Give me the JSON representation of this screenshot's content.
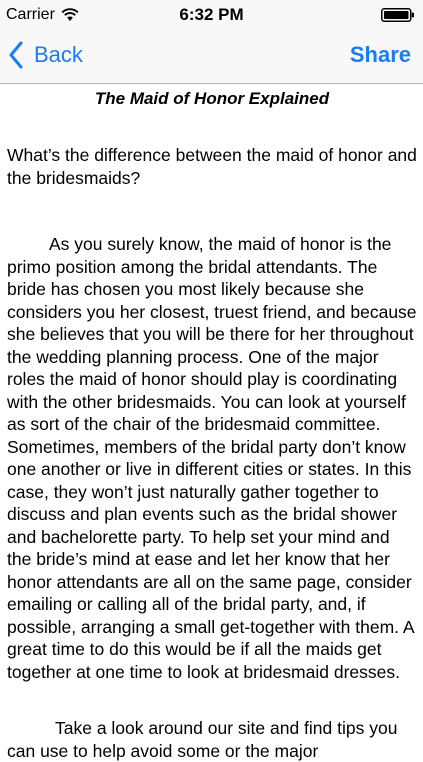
{
  "status_bar": {
    "carrier": "Carrier",
    "time": "6:32 PM",
    "wifi_icon": "wifi-icon",
    "battery_icon": "battery-icon"
  },
  "nav": {
    "back_label": "Back",
    "back_icon": "chevron-left-icon",
    "share_label": "Share",
    "accent_color": "#1a7cf5"
  },
  "article": {
    "title": "The Maid of Honor Explained",
    "question": "What’s the difference between the maid of honor and the bridesmaids?",
    "paragraph_1": "As you surely know, the maid of honor is the primo position among the bridal attendants. The bride has chosen you most likely because she considers you her closest, truest friend, and because she believes that you will be there for her throughout the wedding planning process. One of the major roles the maid of honor should play is coordinating with the other bridesmaids. You can look at yourself as sort of the chair of the bridesmaid committee. Sometimes, members of the bridal party don’t know one another or live in different cities or states. In this case, they won’t just naturally gather together to discuss and plan events such as the bridal shower and bachelorette party. To help set your mind and the bride’s mind at ease and let her know that her honor attendants are all on the same page, consider emailing or calling all of the bridal party, and, if possible, arranging a small get-together with them. A great time to do this would be if all the maids get together at one time to look at bridesmaid dresses.",
    "paragraph_2": "Take a look around our site and find tips you can use to help avoid some or the major"
  }
}
